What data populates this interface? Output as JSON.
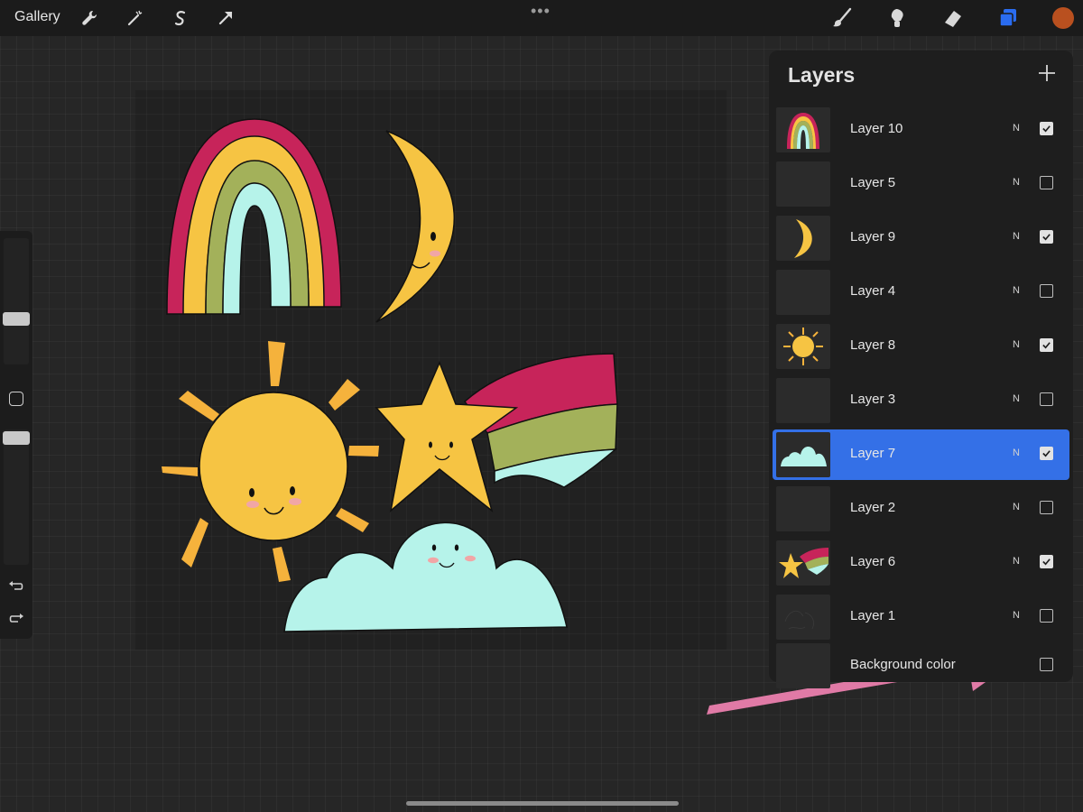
{
  "topbar": {
    "gallery_label": "Gallery",
    "more_label": "•••",
    "color_swatch": "#b9501f",
    "layers_icon_color": "#2a6cf0"
  },
  "layers_panel": {
    "title": "Layers",
    "items": [
      {
        "name": "Layer 10",
        "mode": "N",
        "visible": true,
        "selected": false,
        "thumb": "rainbow"
      },
      {
        "name": "Layer 5",
        "mode": "N",
        "visible": false,
        "selected": false,
        "thumb": "empty"
      },
      {
        "name": "Layer 9",
        "mode": "N",
        "visible": true,
        "selected": false,
        "thumb": "moon"
      },
      {
        "name": "Layer 4",
        "mode": "N",
        "visible": false,
        "selected": false,
        "thumb": "empty"
      },
      {
        "name": "Layer 8",
        "mode": "N",
        "visible": true,
        "selected": false,
        "thumb": "sun"
      },
      {
        "name": "Layer 3",
        "mode": "N",
        "visible": false,
        "selected": false,
        "thumb": "empty"
      },
      {
        "name": "Layer 7",
        "mode": "N",
        "visible": true,
        "selected": true,
        "thumb": "cloud"
      },
      {
        "name": "Layer 2",
        "mode": "N",
        "visible": false,
        "selected": false,
        "thumb": "empty"
      },
      {
        "name": "Layer 6",
        "mode": "N",
        "visible": true,
        "selected": false,
        "thumb": "star"
      },
      {
        "name": "Layer 1",
        "mode": "N",
        "visible": false,
        "selected": false,
        "thumb": "sketch"
      },
      {
        "name": "Background color",
        "mode": "",
        "visible": false,
        "selected": false,
        "thumb": "empty"
      }
    ]
  },
  "colors": {
    "rainbow_red": "#c7245a",
    "rainbow_yellow": "#f6c443",
    "rainbow_green": "#a3b15a",
    "rainbow_mint": "#b6f3ea",
    "sun_yellow": "#f6c443",
    "ray_orange": "#f5b23c",
    "cloud_mint": "#b6f3ea",
    "cheek_pink": "#f1a6a6",
    "annotation_arrow": "#e07aa6"
  }
}
